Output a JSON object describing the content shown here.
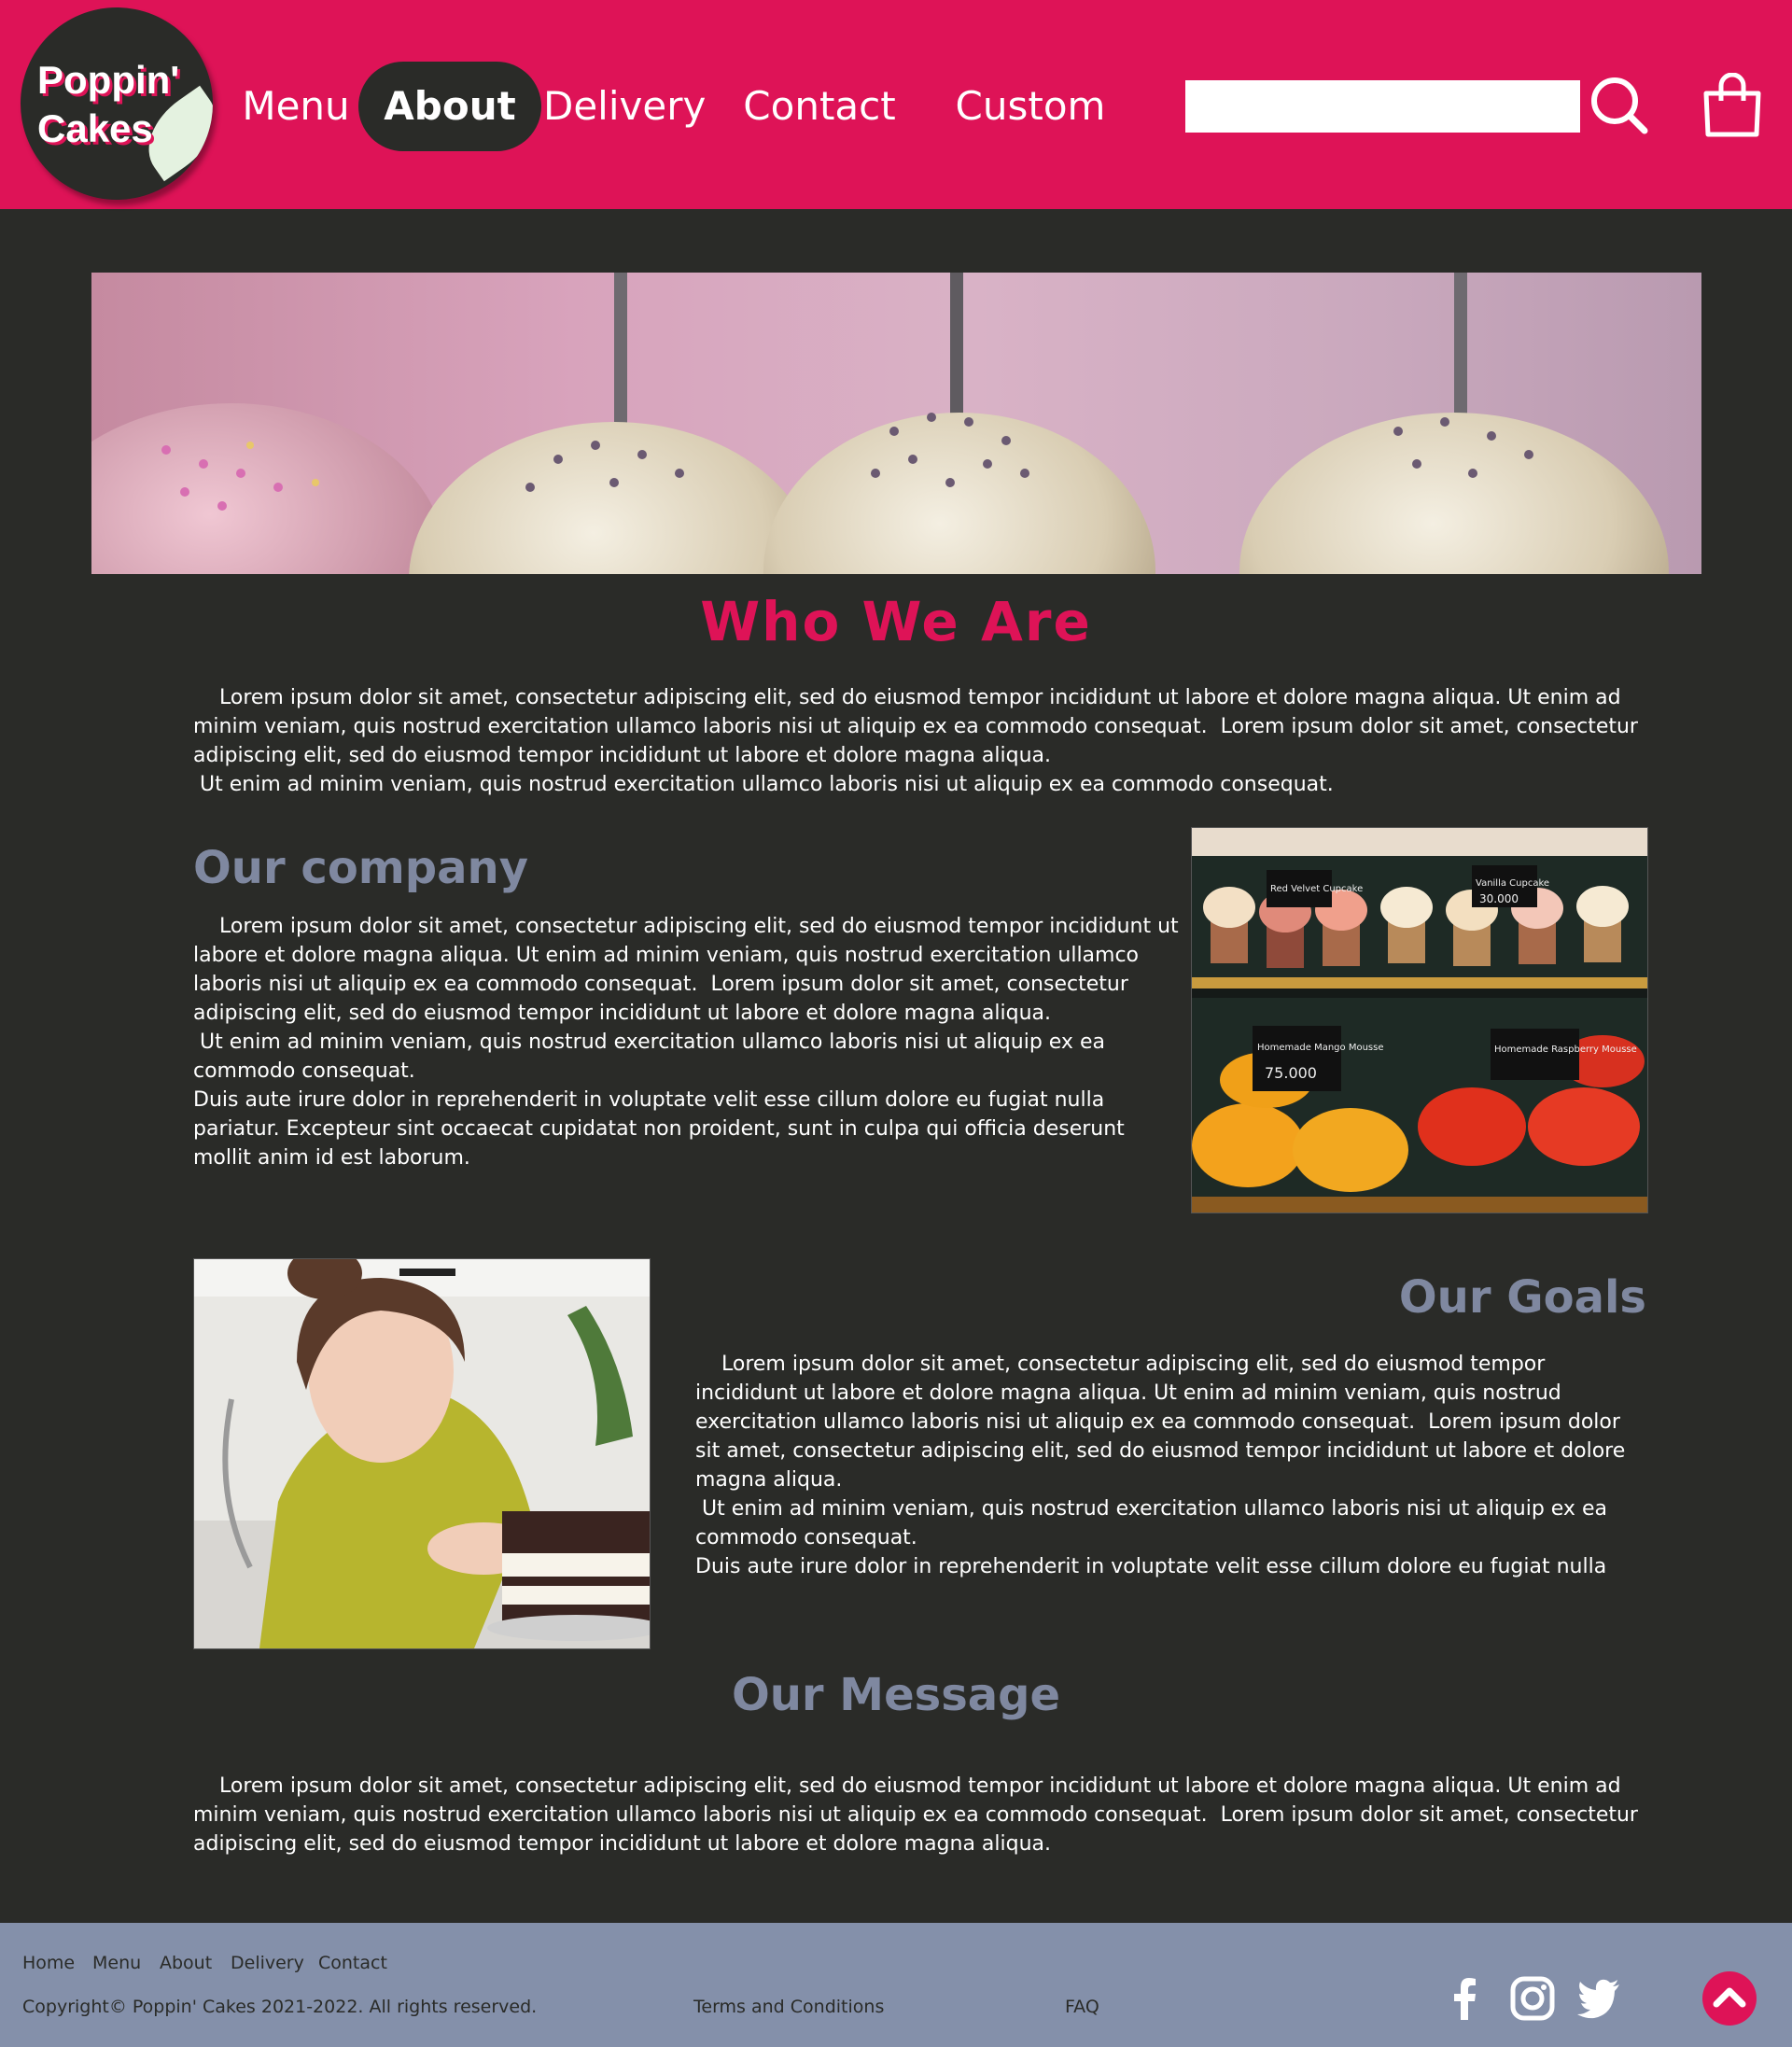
{
  "brand": {
    "line1": "Poppin'",
    "line2": "Cakes",
    "accent": "#de1357",
    "dark": "#2a2b28",
    "muted": "#7f88a0"
  },
  "nav": {
    "items": [
      {
        "label": "Menu"
      },
      {
        "label": "About",
        "active": true
      },
      {
        "label": "Delivery"
      },
      {
        "label": "Contact"
      },
      {
        "label": "Custom"
      }
    ]
  },
  "search": {
    "value": "",
    "placeholder": "",
    "icon": "search-icon"
  },
  "cart": {
    "icon": "shopping-bag-icon"
  },
  "who_we_are": {
    "title": "Who We Are",
    "text": "    Lorem ipsum dolor sit amet, consectetur adipiscing elit, sed do eiusmod tempor incididunt ut labore et dolore magna aliqua. Ut enim ad minim veniam, quis nostrud exercitation ullamco laboris nisi ut aliquip ex ea commodo consequat.  Lorem ipsum dolor sit amet, consectetur adipiscing elit, sed do eiusmod tempor incididunt ut labore et dolore magna aliqua.\n Ut enim ad minim veniam, quis nostrud exercitation ullamco laboris nisi ut aliquip ex ea commodo consequat."
  },
  "our_company": {
    "title": "Our company",
    "text": "    Lorem ipsum dolor sit amet, consectetur adipiscing elit, sed do eiusmod tempor incididunt ut labore et dolore magna aliqua. Ut enim ad minim veniam, quis nostrud exercitation ullamco laboris nisi ut aliquip ex ea commodo consequat.  Lorem ipsum dolor sit amet, consectetur adipiscing elit, sed do eiusmod tempor incididunt ut labore et dolore magna aliqua.\n Ut enim ad minim veniam, quis nostrud exercitation ullamco laboris nisi ut aliquip ex ea commodo consequat.\nDuis aute irure dolor in reprehenderit in voluptate velit esse cillum dolore eu fugiat nulla pariatur. Excepteur sint occaecat cupidatat non proident, sunt in culpa qui officia deserunt mollit anim id est laborum.",
    "sign_1": "Red Velvet Cupcake",
    "sign_2": "Vanilla Cupcake",
    "price_2": "30.000",
    "sign_3": "Homemade Mango Mousse",
    "price_3": "75.000",
    "sign_4": "Homemade Raspberry Mousse"
  },
  "our_goals": {
    "title": "Our Goals",
    "text": "    Lorem ipsum dolor sit amet, consectetur adipiscing elit, sed do eiusmod tempor incididunt ut labore et dolore magna aliqua. Ut enim ad minim veniam, quis nostrud exercitation ullamco laboris nisi ut aliquip ex ea commodo consequat.  Lorem ipsum dolor sit amet, consectetur adipiscing elit, sed do eiusmod tempor incididunt ut labore et dolore magna aliqua.\n Ut enim ad minim veniam, quis nostrud exercitation ullamco laboris nisi ut aliquip ex ea commodo consequat.\nDuis aute irure dolor in reprehenderit in voluptate velit esse cillum dolore eu fugiat nulla"
  },
  "our_message": {
    "title": "Our Message",
    "text": "    Lorem ipsum dolor sit amet, consectetur adipiscing elit, sed do eiusmod tempor incididunt ut labore et dolore magna aliqua. Ut enim ad minim veniam, quis nostrud exercitation ullamco laboris nisi ut aliquip ex ea commodo consequat.  Lorem ipsum dolor sit amet, consectetur adipiscing elit, sed do eiusmod tempor incididunt ut labore et dolore magna aliqua."
  },
  "footer": {
    "links": [
      "Home",
      "Menu",
      "About",
      "Delivery",
      "Contact"
    ],
    "copyright": "Copyright© Poppin' Cakes 2021-2022. All rights reserved.",
    "terms": "Terms and Conditions",
    "faq": "FAQ",
    "social_icons": [
      "facebook-icon",
      "instagram-icon",
      "twitter-icon"
    ],
    "top_icon": "chevron-up-icon"
  }
}
